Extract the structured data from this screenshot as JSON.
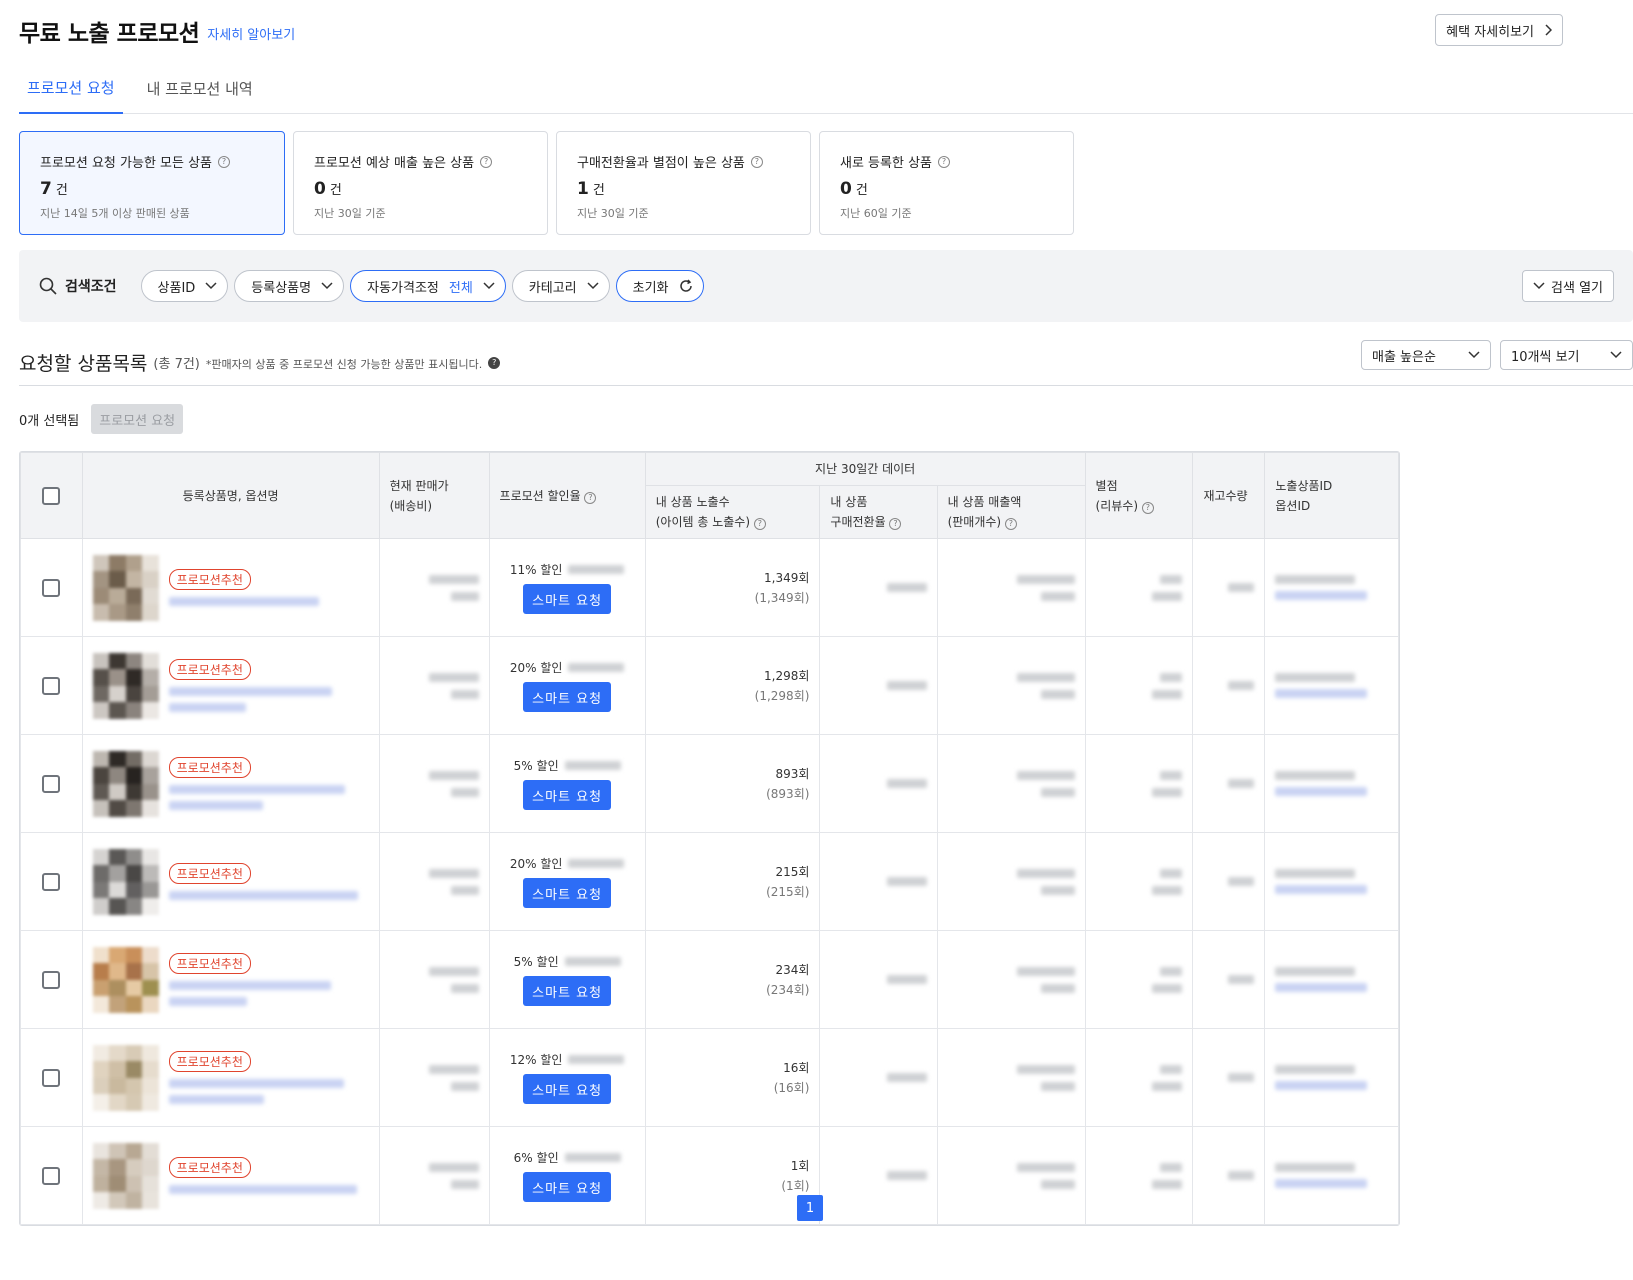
{
  "header": {
    "title": "무료 노출 프로모션",
    "learn_more": "자세히 알아보기",
    "benefit_button": "혜택 자세히보기"
  },
  "tabs": [
    {
      "label": "프로모션 요청",
      "active": true
    },
    {
      "label": "내 프로모션 내역",
      "active": false
    }
  ],
  "summary_cards": [
    {
      "title": "프로모션 요청 가능한 모든 상품",
      "count": "7",
      "unit": "건",
      "sub": "지난 14일 5개 이상 판매된 상품",
      "selected": true
    },
    {
      "title": "프로모션 예상 매출 높은 상품",
      "count": "0",
      "unit": "건",
      "sub": "지난 30일 기준",
      "selected": false
    },
    {
      "title": "구매전환율과 별점이 높은 상품",
      "count": "1",
      "unit": "건",
      "sub": "지난 30일 기준",
      "selected": false
    },
    {
      "title": "새로 등록한 상품",
      "count": "0",
      "unit": "건",
      "sub": "지난 60일 기준",
      "selected": false
    }
  ],
  "filters": {
    "label": "검색조건",
    "chips": [
      {
        "label": "상품ID",
        "value": ""
      },
      {
        "label": "등록상품명",
        "value": ""
      },
      {
        "label": "자동가격조정",
        "value": "전체"
      },
      {
        "label": "카테고리",
        "value": ""
      }
    ],
    "reset": "초기화",
    "open_search": "검색 열기"
  },
  "list": {
    "title": "요청할 상품목록",
    "total": "(총 7건)",
    "note": "*판매자의 상품 중 프로모션 신청 가능한 상품만 표시됩니다.",
    "sort": "매출 높은순",
    "per_page": "10개씩 보기",
    "selected_count": "0개 선택됨",
    "request_button": "프로모션 요청"
  },
  "table": {
    "headers": {
      "product": "등록상품명, 옵션명",
      "price_1": "현재 판매가",
      "price_2": "(배송비)",
      "discount": "프로모션 할인율",
      "group_30d": "지난 30일간 데이터",
      "impressions_1": "내 상품 노출수",
      "impressions_2": "(아이템 총 노출수)",
      "conversion_1": "내 상품",
      "conversion_2": "구매전환율",
      "sales_1": "내 상품 매출액",
      "sales_2": "(판매개수)",
      "rating_1": "별점",
      "rating_2": "(리뷰수)",
      "stock": "재고수량",
      "ids_1": "노출상품ID",
      "ids_2": "옵션ID"
    },
    "rows": [
      {
        "badge": "프로모션추천",
        "discount": "11% 할인",
        "button": "스마트 요청",
        "impressions": "1,349회",
        "impressions_total": "(1,349회)"
      },
      {
        "badge": "프로모션추천",
        "discount": "20% 할인",
        "button": "스마트 요청",
        "impressions": "1,298회",
        "impressions_total": "(1,298회)"
      },
      {
        "badge": "프로모션추천",
        "discount": "5% 할인",
        "button": "스마트 요청",
        "impressions": "893회",
        "impressions_total": "(893회)"
      },
      {
        "badge": "프로모션추천",
        "discount": "20% 할인",
        "button": "스마트 요청",
        "impressions": "215회",
        "impressions_total": "(215회)"
      },
      {
        "badge": "프로모션추천",
        "discount": "5% 할인",
        "button": "스마트 요청",
        "impressions": "234회",
        "impressions_total": "(234회)"
      },
      {
        "badge": "프로모션추천",
        "discount": "12% 할인",
        "button": "스마트 요청",
        "impressions": "16회",
        "impressions_total": "(16회)"
      },
      {
        "badge": "프로모션추천",
        "discount": "6% 할인",
        "button": "스마트 요청",
        "impressions": "1회",
        "impressions_total": "(1회)"
      }
    ]
  },
  "pagination": {
    "current": "1"
  },
  "colors": {
    "accent": "#2d6df6",
    "badge": "#e0442e"
  }
}
